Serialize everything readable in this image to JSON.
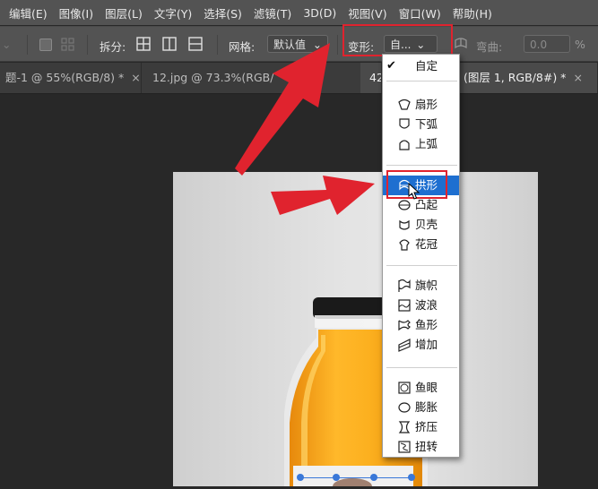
{
  "menubar": {
    "items": [
      "编辑(E)",
      "图像(I)",
      "图层(L)",
      "文字(Y)",
      "选择(S)",
      "滤镜(T)",
      "3D(D)",
      "视图(V)",
      "窗口(W)",
      "帮助(H)"
    ]
  },
  "options": {
    "split_label": "拆分:",
    "grid_label": "网格:",
    "grid_value": "默认值",
    "warp_label": "变形:",
    "warp_value": "自...",
    "bend_label": "弯曲:",
    "bend_value": "0.0",
    "percent": "%"
  },
  "tabs": [
    {
      "label": "题-1 @ 55%(RGB/8) *",
      "close": "×"
    },
    {
      "label": "12.jpg @ 73.3%(RGB/",
      "close": "×"
    },
    {
      "label": "42",
      "close": ""
    },
    {
      "label": "(图层 1, RGB/8#) *",
      "close": "×"
    }
  ],
  "warp_menu": {
    "checkmark": "✔",
    "items": [
      {
        "label": "自定",
        "icon": "none",
        "checked": true
      },
      {
        "label": "扇形",
        "icon": "arc-icon"
      },
      {
        "label": "下弧",
        "icon": "arc-lower-icon"
      },
      {
        "label": "上弧",
        "icon": "arc-upper-icon"
      },
      {
        "label": "拱形",
        "icon": "arch-icon",
        "selected": true
      },
      {
        "label": "凸起",
        "icon": "bulge-icon"
      },
      {
        "label": "贝壳",
        "icon": "shell-icon"
      },
      {
        "label": "花冠",
        "icon": "flower-icon"
      },
      {
        "label": "旗帜",
        "icon": "flag-icon"
      },
      {
        "label": "波浪",
        "icon": "wave-icon"
      },
      {
        "label": "鱼形",
        "icon": "fish-icon"
      },
      {
        "label": "增加",
        "icon": "rise-icon"
      },
      {
        "label": "鱼眼",
        "icon": "fisheye-icon"
      },
      {
        "label": "膨胀",
        "icon": "inflate-icon"
      },
      {
        "label": "挤压",
        "icon": "squeeze-icon"
      },
      {
        "label": "扭转",
        "icon": "twist-icon"
      }
    ]
  },
  "colors": {
    "annotation_red": "#e0232e",
    "menu_highlight": "#1e6fd0",
    "juice_orange": "#f5a51a",
    "cap_black": "#1a1a1a"
  }
}
